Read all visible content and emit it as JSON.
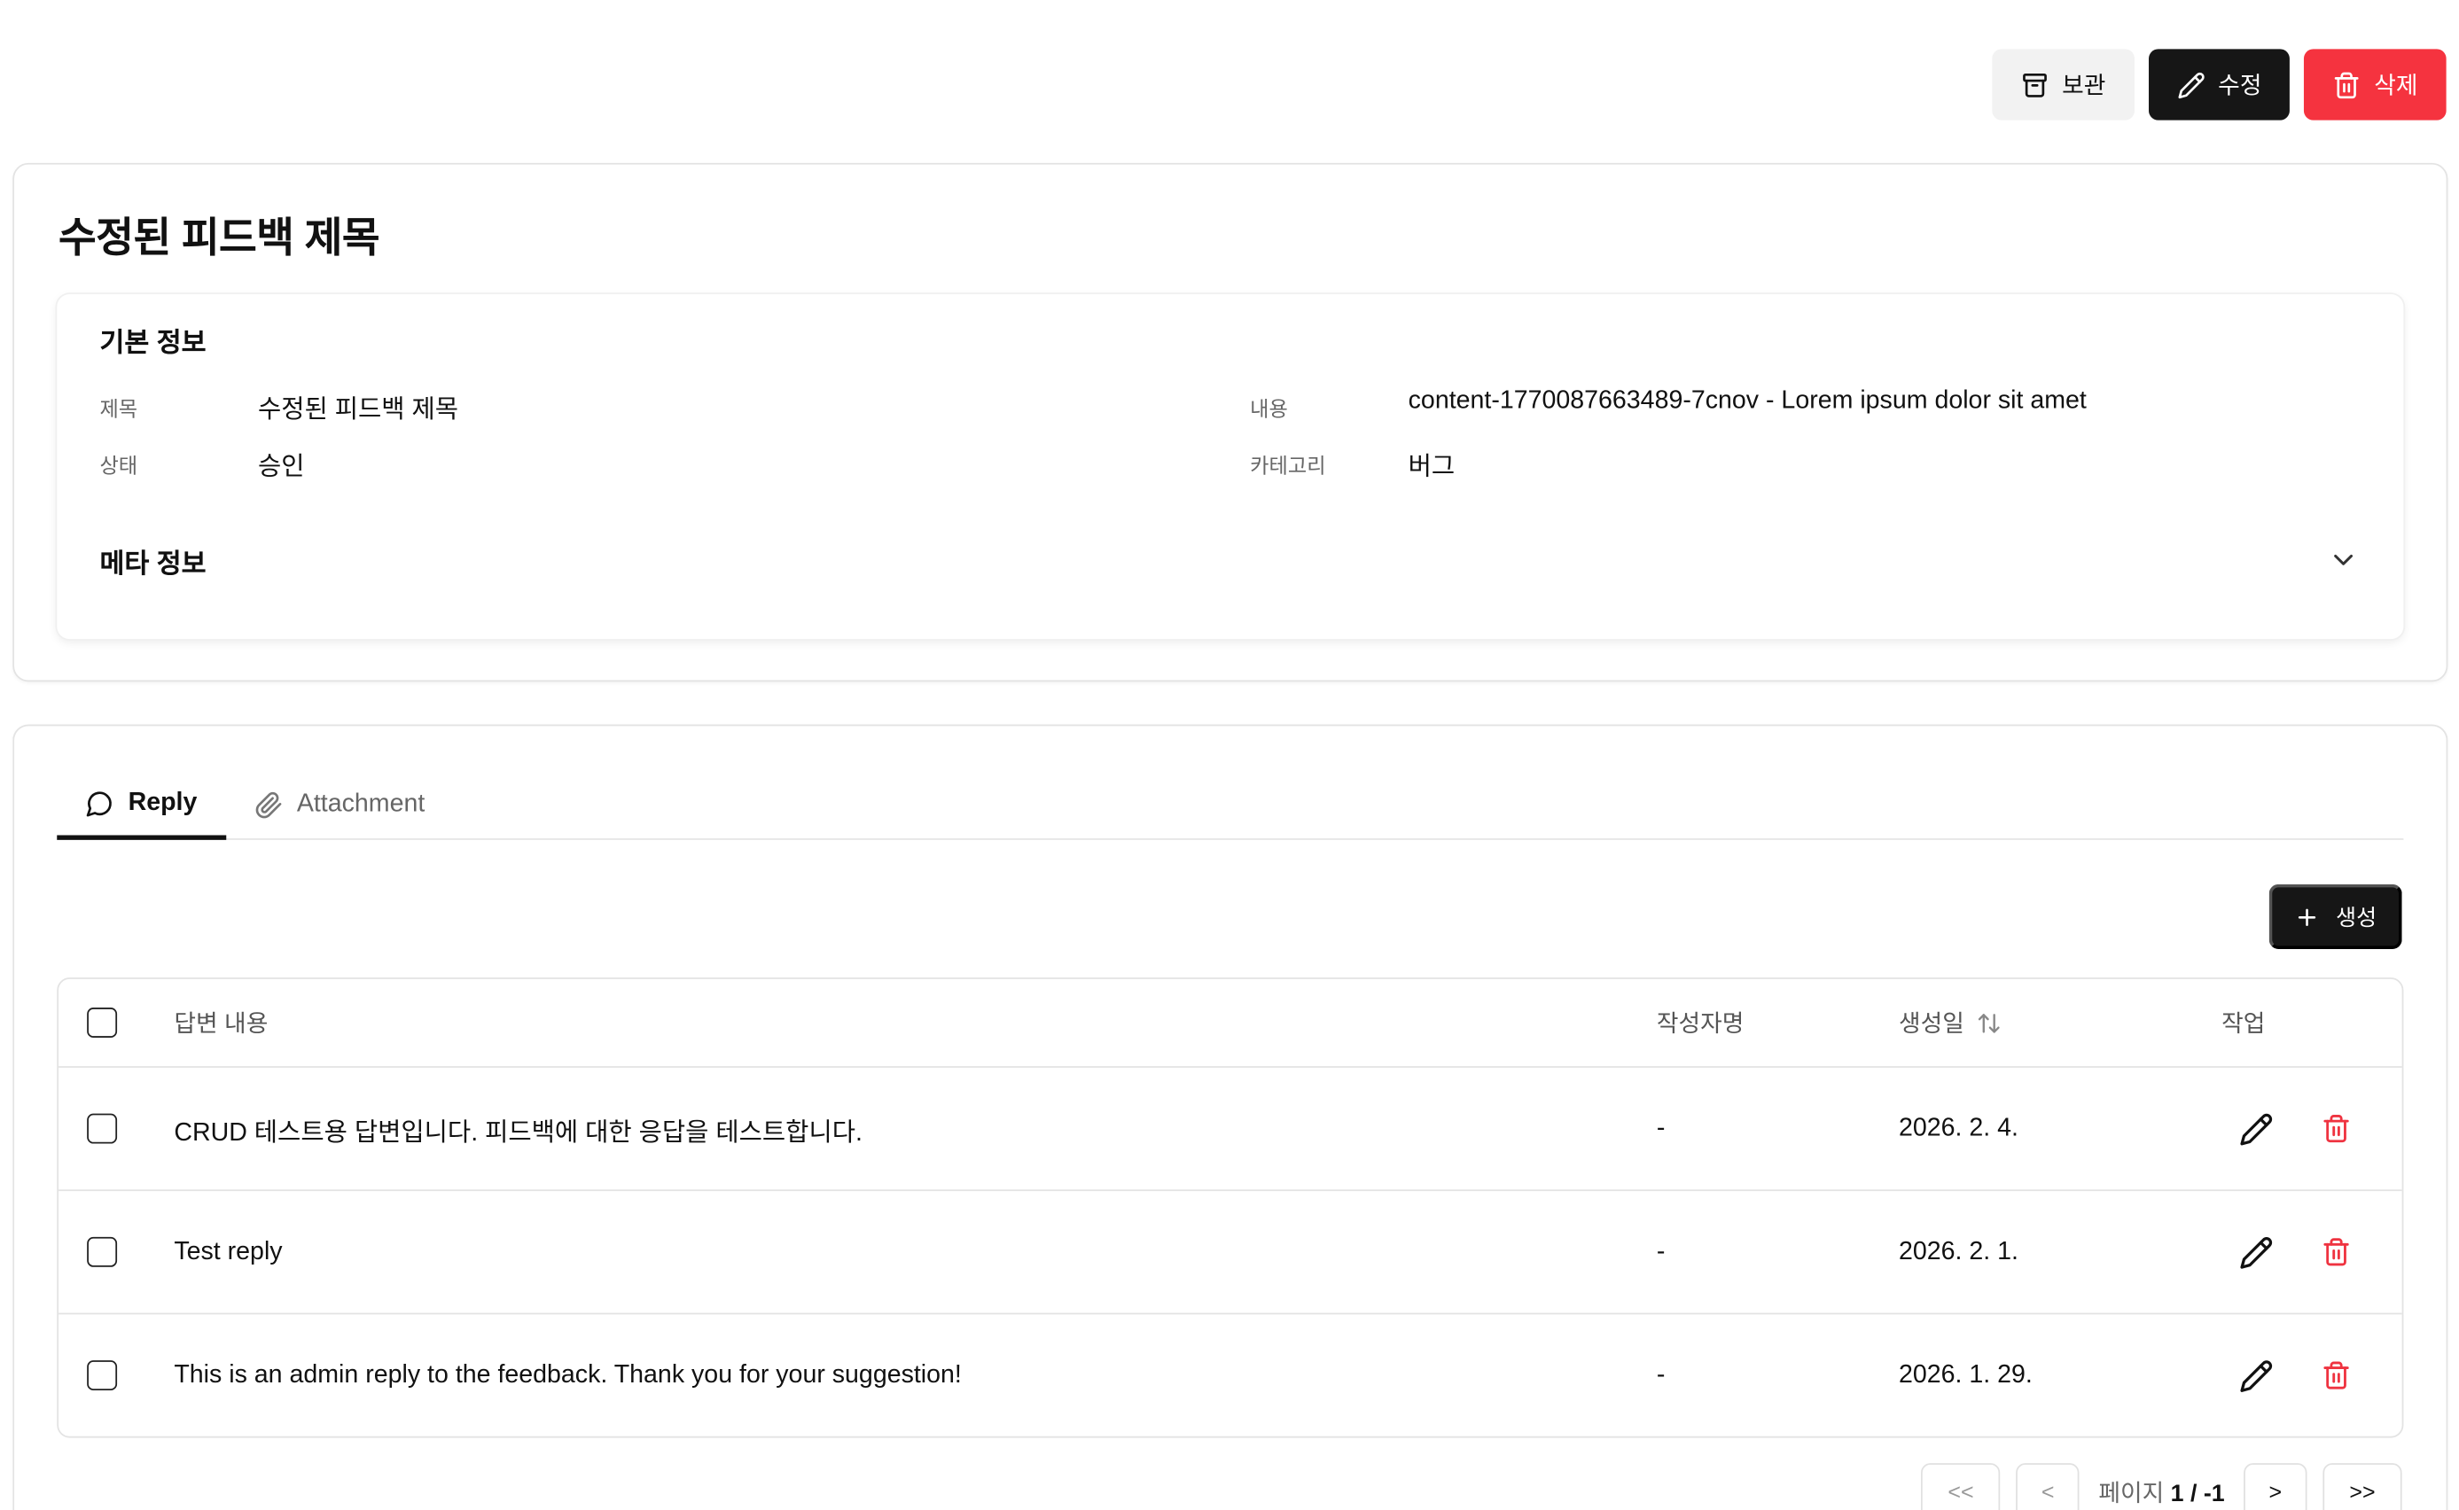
{
  "toolbar": {
    "archive_label": "보관",
    "edit_label": "수정",
    "delete_label": "삭제"
  },
  "detail": {
    "title": "수정된 피드백 제목",
    "basic_info": {
      "section_title": "기본 정보",
      "fields": [
        {
          "label": "제목",
          "value": "수정된 피드백 제목"
        },
        {
          "label": "상태",
          "value": "승인"
        },
        {
          "label": "내용",
          "value": "content-1770087663489-7cnov - Lorem ipsum dolor sit amet"
        },
        {
          "label": "카테고리",
          "value": "버그"
        }
      ]
    },
    "meta_info": {
      "section_title": "메타 정보",
      "expanded": false
    }
  },
  "tabs": [
    {
      "label": "Reply",
      "icon": "message-circle-icon",
      "active": true
    },
    {
      "label": "Attachment",
      "icon": "paperclip-icon",
      "active": false
    }
  ],
  "create_label": "생성",
  "table": {
    "columns": [
      "답변 내용",
      "작성자명",
      "생성일",
      "작업"
    ],
    "rows": [
      {
        "content": "CRUD 테스트용 답변입니다. 피드백에 대한 응답을 테스트합니다.",
        "author": "-",
        "created": "2026. 2. 4."
      },
      {
        "content": "Test reply",
        "author": "-",
        "created": "2026. 2. 1."
      },
      {
        "content": "This is an admin reply to the feedback. Thank you for your suggestion!",
        "author": "-",
        "created": "2026. 1. 29."
      }
    ]
  },
  "pagination": {
    "first": "<<",
    "prev": "<",
    "page_label": "페이지",
    "page_value": "1 / -1",
    "next": ">",
    "last": ">>"
  }
}
